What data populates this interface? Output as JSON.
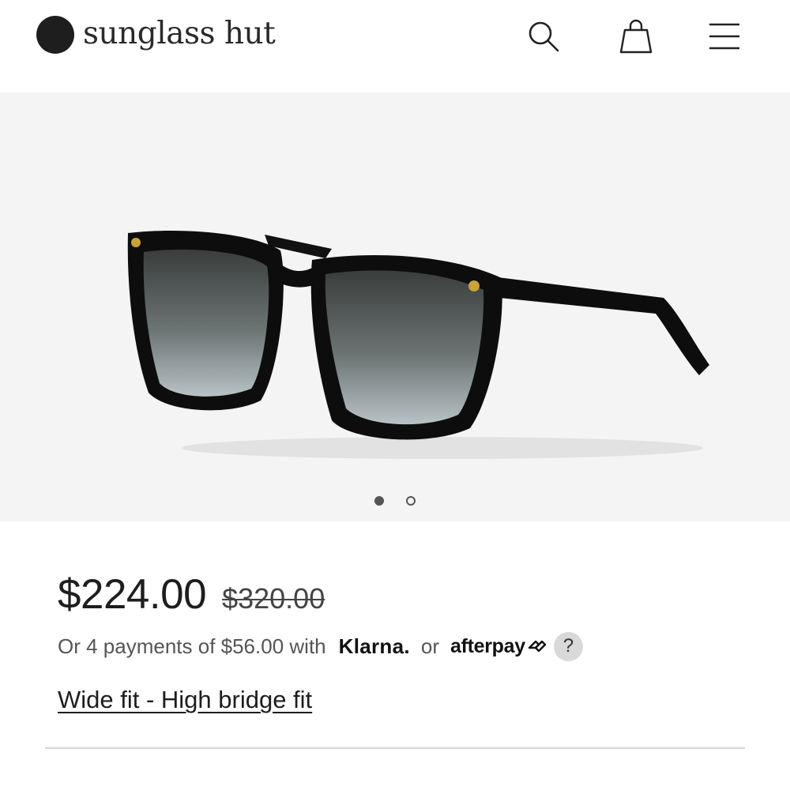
{
  "header": {
    "brand": "sunglass hut",
    "icons": [
      "search-icon",
      "shopping-bag-icon",
      "menu-icon"
    ]
  },
  "gallery": {
    "image_alt": "Black square sunglasses with gradient grey lenses",
    "slides_total": 2,
    "active_slide": 1
  },
  "product": {
    "price_current": "$224.00",
    "price_original": "$320.00",
    "payments_prefix": "Or 4 payments of $56.00 with",
    "klarna_label": "Klarna.",
    "or_label": "or",
    "afterpay_label": "afterpay",
    "help_label": "?",
    "fit_link": "Wide fit - High bridge fit"
  },
  "colors": {
    "gallery_bg": "#f4f4f4",
    "text_primary": "#1e1e1e",
    "text_secondary": "#555555",
    "divider": "#d6d6d6"
  }
}
